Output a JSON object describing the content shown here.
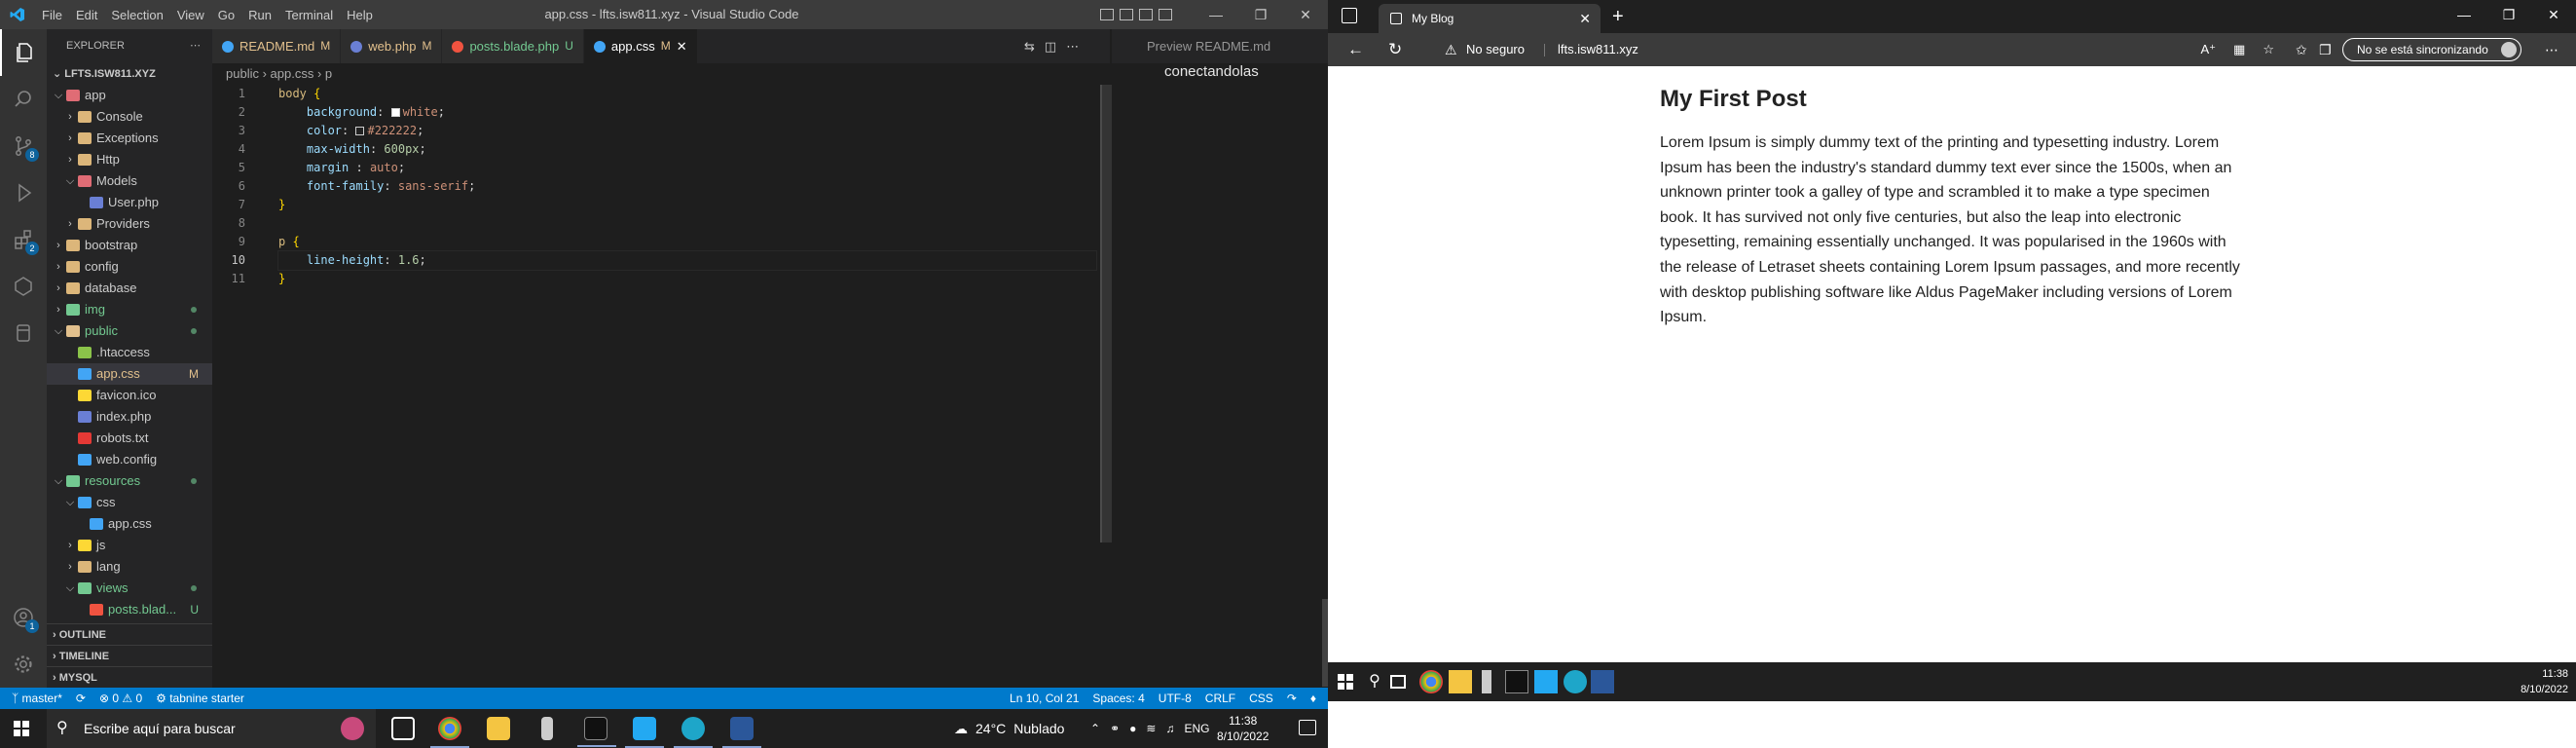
{
  "vscode": {
    "menu": [
      "File",
      "Edit",
      "Selection",
      "View",
      "Go",
      "Run",
      "Terminal",
      "Help"
    ],
    "window_title": "app.css - lfts.isw811.xyz - Visual Studio Code",
    "explorer_header": "EXPLORER",
    "root_folder": "LFTS.ISW811.XYZ",
    "tree": [
      {
        "label": "app",
        "level": 1,
        "type": "folder-open",
        "color": "#e06c75",
        "status": ""
      },
      {
        "label": "Console",
        "level": 2,
        "type": "folder",
        "color": "#dcb67a",
        "status": ""
      },
      {
        "label": "Exceptions",
        "level": 2,
        "type": "folder",
        "color": "#dcb67a",
        "status": ""
      },
      {
        "label": "Http",
        "level": 2,
        "type": "folder",
        "color": "#dcb67a",
        "status": ""
      },
      {
        "label": "Models",
        "level": 2,
        "type": "folder-open",
        "color": "#e06c75",
        "status": ""
      },
      {
        "label": "User.php",
        "level": 3,
        "type": "file",
        "color": "#6a7fd4",
        "status": ""
      },
      {
        "label": "Providers",
        "level": 2,
        "type": "folder",
        "color": "#dcb67a",
        "status": ""
      },
      {
        "label": "bootstrap",
        "level": 1,
        "type": "folder",
        "color": "#dcb67a",
        "status": ""
      },
      {
        "label": "config",
        "level": 1,
        "type": "folder",
        "color": "#dcb67a",
        "status": ""
      },
      {
        "label": "database",
        "level": 1,
        "type": "folder",
        "color": "#dcb67a",
        "status": ""
      },
      {
        "label": "img",
        "level": 1,
        "type": "folder",
        "color": "#73c991",
        "status": "dot"
      },
      {
        "label": "public",
        "level": 1,
        "type": "folder-open",
        "color": "#e2c08d",
        "status": "dot"
      },
      {
        "label": ".htaccess",
        "level": 2,
        "type": "file",
        "color": "#8bc34a",
        "status": ""
      },
      {
        "label": "app.css",
        "level": 2,
        "type": "file",
        "color": "#42a5f5",
        "status": "M",
        "selected": true
      },
      {
        "label": "favicon.ico",
        "level": 2,
        "type": "file",
        "color": "#fdd835",
        "status": ""
      },
      {
        "label": "index.php",
        "level": 2,
        "type": "file",
        "color": "#6a7fd4",
        "status": ""
      },
      {
        "label": "robots.txt",
        "level": 2,
        "type": "file",
        "color": "#e53935",
        "status": ""
      },
      {
        "label": "web.config",
        "level": 2,
        "type": "file",
        "color": "#42a5f5",
        "status": ""
      },
      {
        "label": "resources",
        "level": 1,
        "type": "folder-open",
        "color": "#73c991",
        "status": "dot"
      },
      {
        "label": "css",
        "level": 2,
        "type": "folder-open",
        "color": "#42a5f5",
        "status": ""
      },
      {
        "label": "app.css",
        "level": 3,
        "type": "file",
        "color": "#42a5f5",
        "status": ""
      },
      {
        "label": "js",
        "level": 2,
        "type": "folder",
        "color": "#fdd835",
        "status": ""
      },
      {
        "label": "lang",
        "level": 2,
        "type": "folder",
        "color": "#dcb67a",
        "status": ""
      },
      {
        "label": "views",
        "level": 2,
        "type": "folder-open",
        "color": "#73c991",
        "status": "dot"
      },
      {
        "label": "posts.blad...",
        "level": 3,
        "type": "file",
        "color": "#f05340",
        "status": "U"
      }
    ],
    "sections": [
      "OUTLINE",
      "TIMELINE",
      "MYSQL"
    ],
    "tabs": [
      {
        "label": "README.md",
        "marker": "M",
        "icon_color": "#42a5f5",
        "active": false
      },
      {
        "label": "web.php",
        "marker": "M",
        "icon_color": "#6a7fd4",
        "active": false
      },
      {
        "label": "posts.blade.php",
        "marker": "U",
        "icon_color": "#f05340",
        "active": false
      },
      {
        "label": "app.css",
        "marker": "M",
        "icon_color": "#42a5f5",
        "active": true
      }
    ],
    "breadcrumb": [
      "public",
      "app.css",
      "p"
    ],
    "code_lines": [
      "body {",
      "    background: white;",
      "    color: #222222;",
      "    max-width: 600px;",
      "    margin : auto;",
      "    font-family: sans-serif;",
      "}",
      "",
      "p {",
      "    line-height: 1.6;",
      "}"
    ],
    "line_numbers": [
      "1",
      "2",
      "3",
      "4",
      "5",
      "6",
      "7",
      "8",
      "9",
      "10",
      "11"
    ],
    "current_line": 10,
    "preview_tab_label": "Preview README.md",
    "preview_text": "conectandolas",
    "statusbar": {
      "branch": "master*",
      "problems": "⊗ 0 ⚠ 0",
      "tabnine": "tabnine starter",
      "cursor": "Ln 10, Col 21",
      "spaces": "Spaces: 4",
      "encoding": "UTF-8",
      "eol": "CRLF",
      "language": "CSS"
    },
    "accent": "#007acc"
  },
  "browser": {
    "tab_title": "My Blog",
    "security": "No seguro",
    "url": "lfts.isw811.xyz",
    "sync_label": "No se está sincronizando",
    "post_title": "My First Post",
    "post_body": "Lorem Ipsum is simply dummy text of the printing and typesetting industry. Lorem Ipsum has been the industry's standard dummy text ever since the 1500s, when an unknown printer took a galley of type and scrambled it to make a type specimen book. It has survived not only five centuries, but also the leap into electronic typesetting, remaining essentially unchanged. It was popularised in the 1960s with the release of Letraset sheets containing Lorem Ipsum passages, and more recently with desktop publishing software like Aldus PageMaker including versions of Lorem Ipsum.",
    "clock_time": "11:38",
    "clock_date": "8/10/2022"
  },
  "taskbar": {
    "search_placeholder": "Escribe aquí para buscar",
    "weather": "24°C",
    "weather_desc": "Nublado",
    "lang": "ENG",
    "time": "11:38",
    "date": "8/10/2022"
  }
}
